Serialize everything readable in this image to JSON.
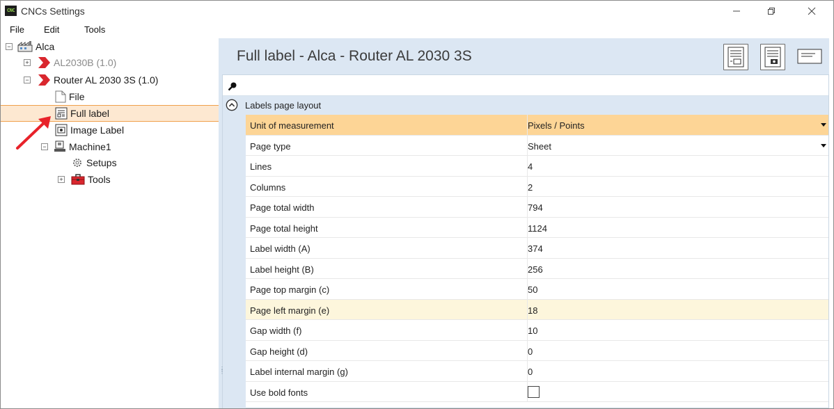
{
  "window": {
    "title": "CNCs Settings",
    "app_icon_text": "CNC",
    "controls": [
      "minimize",
      "maximize",
      "close"
    ]
  },
  "menu": {
    "file": "File",
    "edit": "Edit",
    "tools": "Tools"
  },
  "tree": {
    "root": "Alca",
    "machine_a": "AL2030B (1.0)",
    "machine_b": "Router AL 2030 3S (1.0)",
    "file": "File",
    "full_label": "Full label",
    "image_label": "Image Label",
    "machine1": "Machine1",
    "setups": "Setups",
    "tools": "Tools",
    "expander_collapse": "−",
    "expander_expand": "+"
  },
  "header": {
    "title": "Full label - Alca - Router AL 2030 3S"
  },
  "properties": {
    "section": "Labels page layout",
    "rows": [
      {
        "name": "Unit of measurement",
        "value": "Pixels / Points"
      },
      {
        "name": "Page type",
        "value": "Sheet"
      },
      {
        "name": "Lines",
        "value": "4"
      },
      {
        "name": "Columns",
        "value": "2"
      },
      {
        "name": "Page total width",
        "value": "794"
      },
      {
        "name": "Page total height",
        "value": "1124"
      },
      {
        "name": "Label width (A)",
        "value": "374"
      },
      {
        "name": "Label height (B)",
        "value": "256"
      },
      {
        "name": "Page top margin (c)",
        "value": "50"
      },
      {
        "name": "Page left margin (e)",
        "value": "18"
      },
      {
        "name": "Gap width (f)",
        "value": "10"
      },
      {
        "name": "Gap height (d)",
        "value": "0"
      },
      {
        "name": "Label internal margin (g)",
        "value": "0"
      },
      {
        "name": "Use bold fonts",
        "value": ""
      }
    ],
    "use_bold_fonts_checked": false
  },
  "colors": {
    "accent": "#f0a04b",
    "selected_bg": "#fde8d1",
    "pane_bg": "#dce7f3",
    "highlight_row": "#fdd596",
    "machine_icon": "#d9272e"
  }
}
